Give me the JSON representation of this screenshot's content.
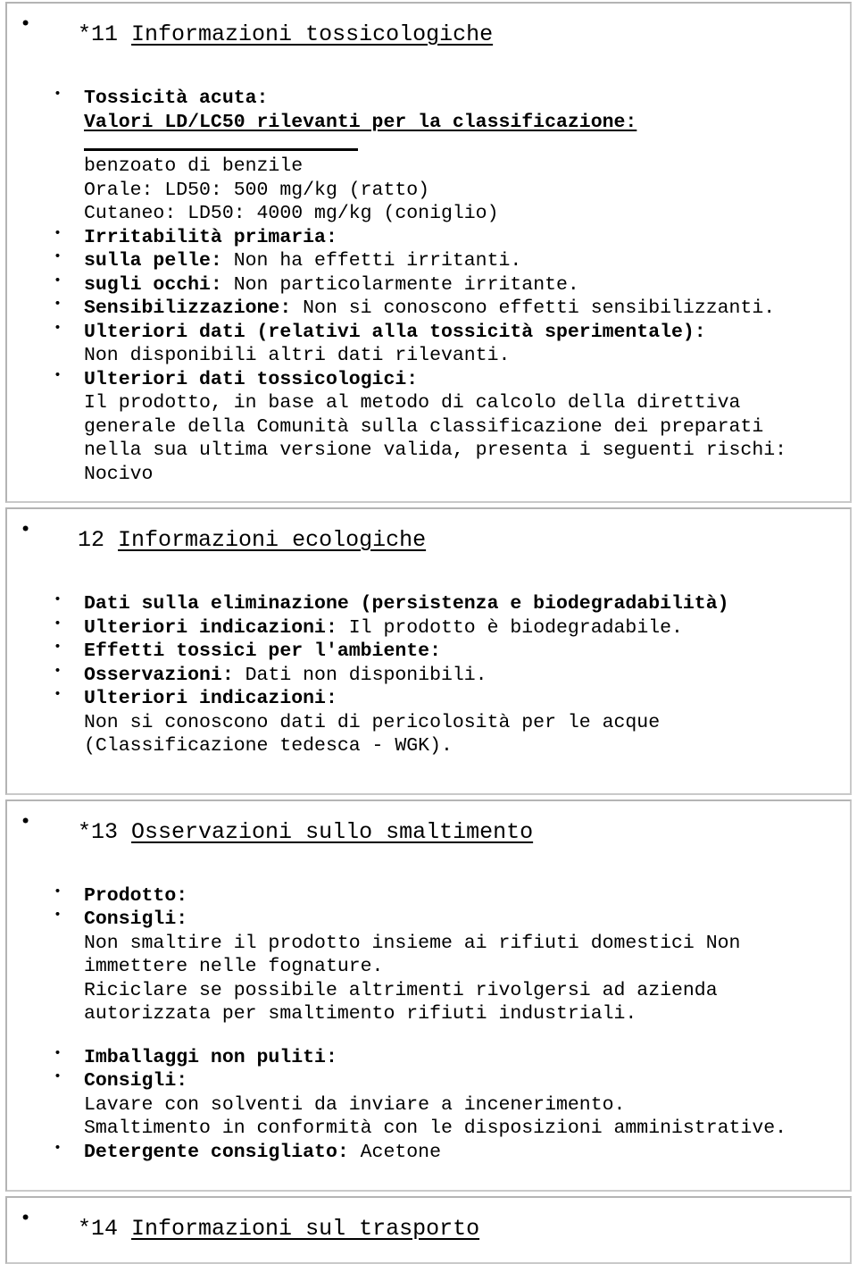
{
  "document": {
    "language": "it",
    "kind": "safety-data-sheet-page"
  },
  "sections": [
    {
      "id": "sec-11",
      "heading_number": "*11",
      "heading_title": "Informazioni tossicologiche",
      "blocks": [
        {
          "type": "bullet-bold",
          "label": "Tossicità acuta:"
        },
        {
          "type": "sub-underlined",
          "text": "Valori LD/LC50 rilevanti per la classificazione:"
        },
        {
          "type": "rule"
        },
        {
          "type": "sub-plain",
          "text": "benzoato di benzile"
        },
        {
          "type": "sub-plain",
          "text": "Orale: LD50: 500 mg/kg (ratto)"
        },
        {
          "type": "sub-plain",
          "text": "Cutaneo: LD50: 4000 mg/kg (coniglio)"
        },
        {
          "type": "bullet-bold",
          "label": "Irritabilità primaria:"
        },
        {
          "type": "bullet-pair",
          "label": "sulla pelle:",
          "value": "Non ha effetti irritanti."
        },
        {
          "type": "bullet-pair",
          "label": "sugli occhi:",
          "value": "Non particolarmente irritante."
        },
        {
          "type": "bullet-pair",
          "label": "Sensibilizzazione:",
          "value": "Non si conoscono effetti sensibilizzanti."
        },
        {
          "type": "bullet-bold",
          "label": "Ulteriori dati (relativi alla tossicità sperimentale):"
        },
        {
          "type": "sub-plain",
          "text": "Non disponibili altri dati rilevanti."
        },
        {
          "type": "bullet-bold",
          "label": "Ulteriori dati tossicologici:"
        },
        {
          "type": "sub-plain",
          "text": "Il prodotto, in base al metodo di calcolo della direttiva"
        },
        {
          "type": "sub-plain",
          "text": "generale della Comunità sulla classificazione dei preparati"
        },
        {
          "type": "sub-plain",
          "text": "nella sua ultima versione valida, presenta i seguenti rischi:"
        },
        {
          "type": "sub-plain",
          "text": "Nocivo"
        }
      ]
    },
    {
      "id": "sec-12",
      "heading_number": "12",
      "heading_title": "Informazioni ecologiche",
      "blocks": [
        {
          "type": "bullet-bold",
          "label": "Dati sulla eliminazione (persistenza e biodegradabilità)"
        },
        {
          "type": "bullet-pair",
          "label": "Ulteriori indicazioni:",
          "value": "Il prodotto è biodegradabile."
        },
        {
          "type": "bullet-bold",
          "label": "Effetti tossici per l'ambiente:"
        },
        {
          "type": "bullet-pair",
          "label": "Osservazioni:",
          "value": "Dati non disponibili."
        },
        {
          "type": "bullet-bold",
          "label": "Ulteriori indicazioni:"
        },
        {
          "type": "sub-plain",
          "text": "Non si conoscono dati di pericolosità per le acque"
        },
        {
          "type": "sub-plain",
          "text": "(Classificazione tedesca - WGK)."
        }
      ]
    },
    {
      "id": "sec-13",
      "heading_number": "*13",
      "heading_title": "Osservazioni sullo smaltimento",
      "blocks": [
        {
          "type": "bullet-bold",
          "label": "Prodotto:"
        },
        {
          "type": "bullet-bold",
          "label": "Consigli:"
        },
        {
          "type": "sub-plain",
          "text": "Non smaltire il prodotto insieme ai rifiuti domestici Non"
        },
        {
          "type": "sub-plain",
          "text": "immettere nelle fognature."
        },
        {
          "type": "sub-plain",
          "text": "Riciclare se possibile altrimenti rivolgersi ad azienda"
        },
        {
          "type": "sub-plain",
          "text": "autorizzata per smaltimento rifiuti industriali."
        },
        {
          "type": "gap"
        },
        {
          "type": "bullet-bold",
          "label": "Imballaggi non puliti:"
        },
        {
          "type": "bullet-bold",
          "label": "Consigli:"
        },
        {
          "type": "sub-plain",
          "text": "Lavare con solventi da inviare a incenerimento."
        },
        {
          "type": "sub-plain",
          "text": "Smaltimento in conformità con le disposizioni amministrative."
        },
        {
          "type": "bullet-pair",
          "label": "Detergente consigliato:",
          "value": "Acetone"
        }
      ]
    },
    {
      "id": "sec-14",
      "heading_number": "*14",
      "heading_title": "Informazioni sul trasporto",
      "blocks": []
    }
  ],
  "colors": {
    "text": "#000000",
    "background": "#ffffff",
    "frame_border": "#c9c9c9"
  }
}
